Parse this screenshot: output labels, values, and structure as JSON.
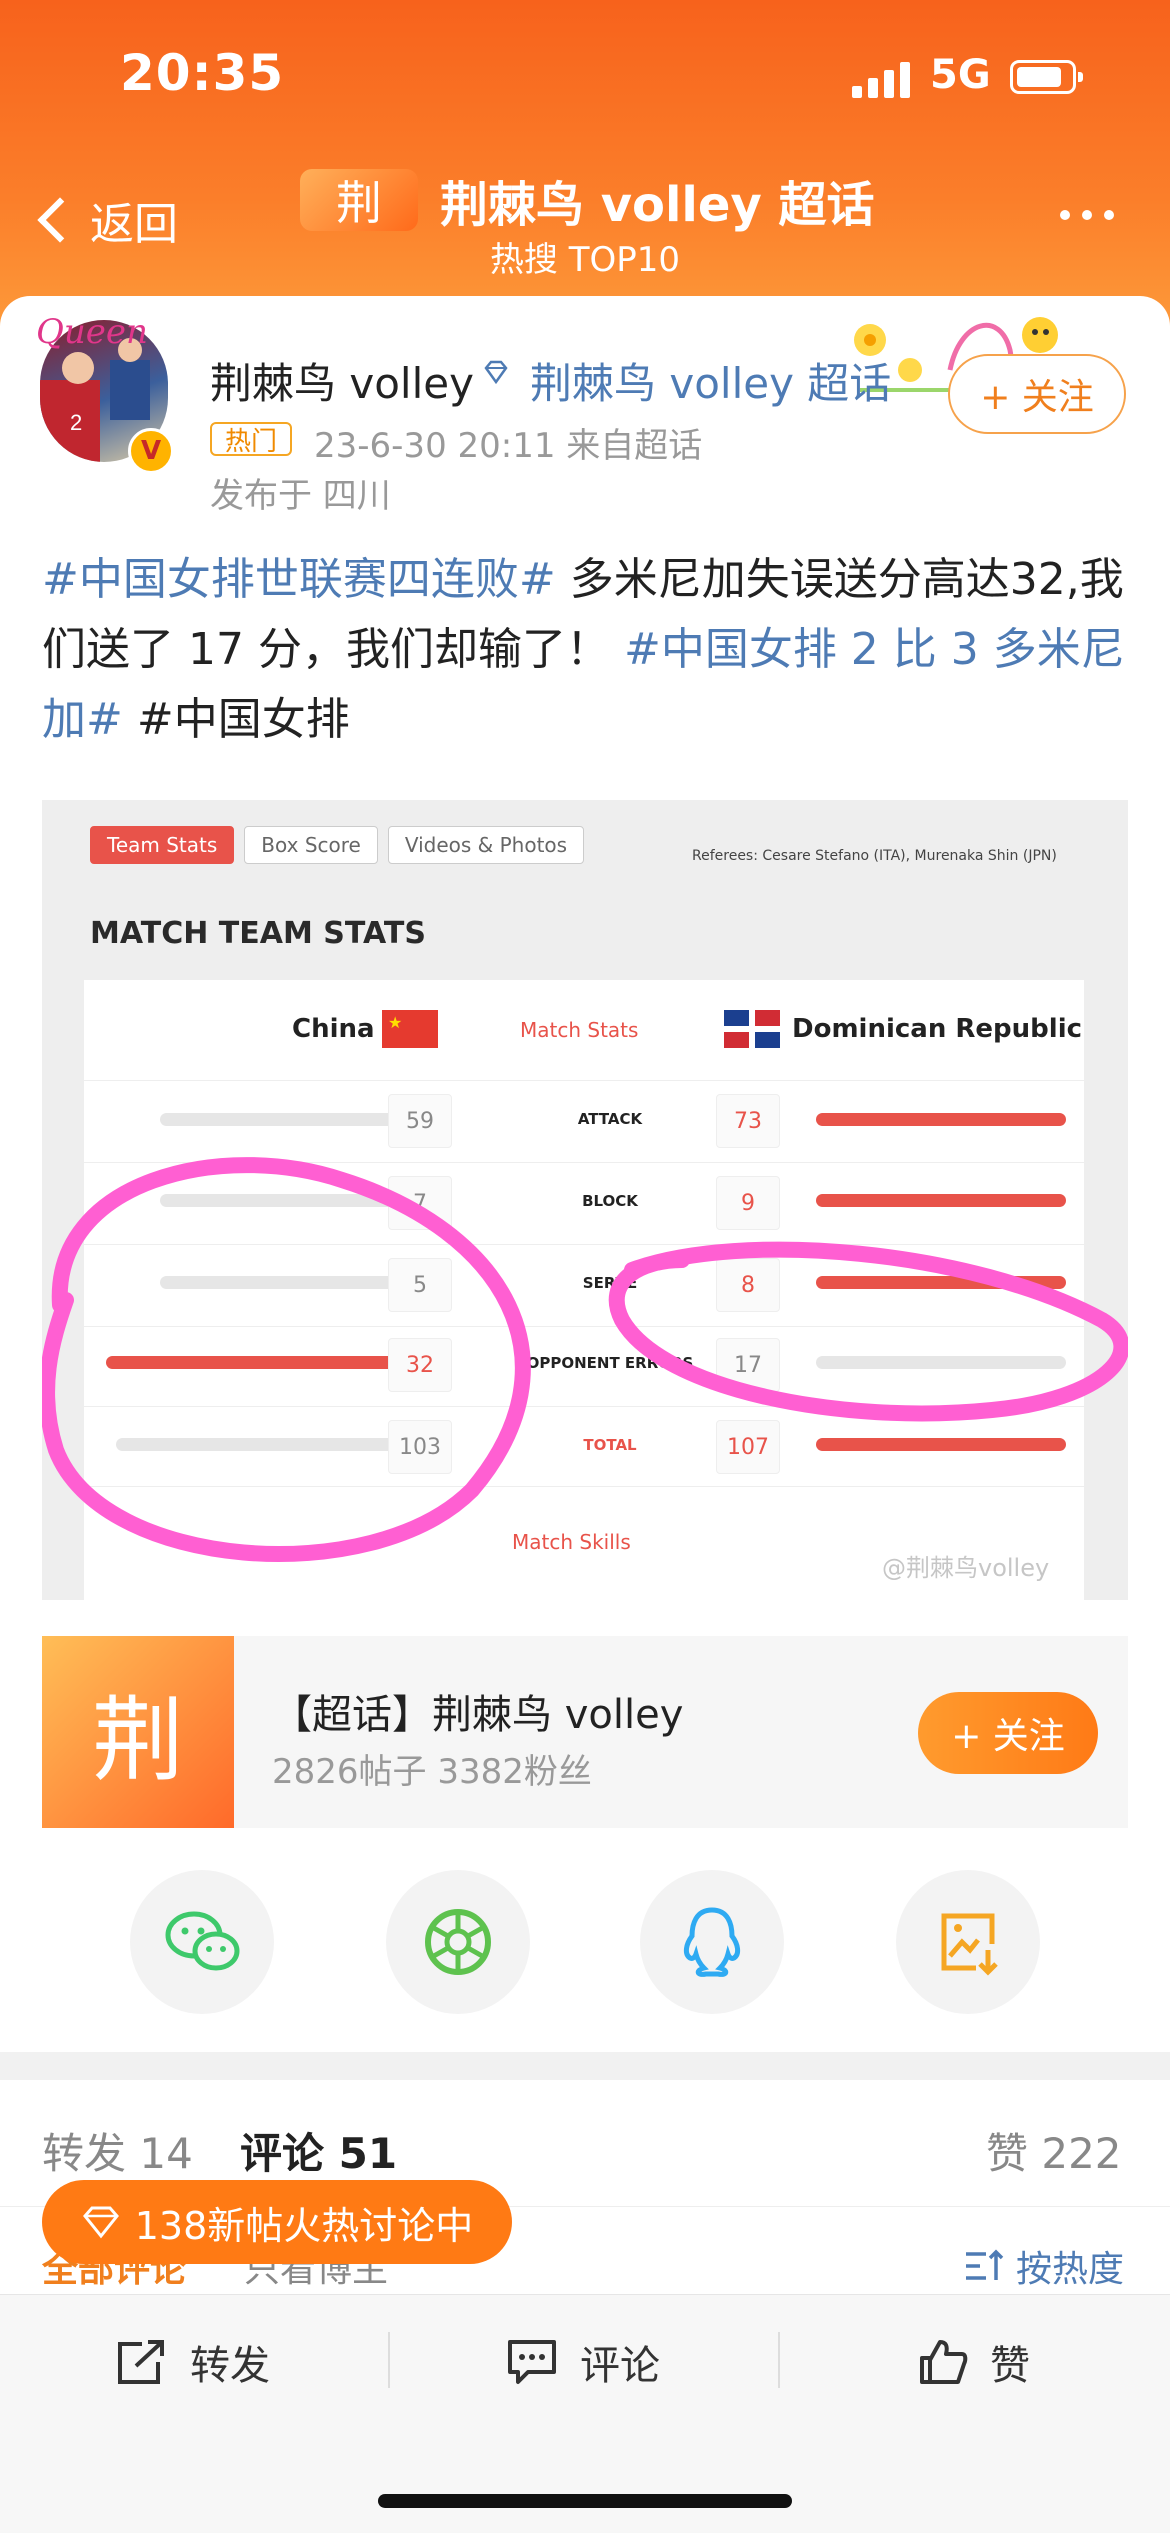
{
  "status": {
    "time": "20:35",
    "network": "5G"
  },
  "header": {
    "back_label": "返回",
    "title_logo": "荆",
    "title": "荆棘鸟 volley 超话",
    "subtitle": "热搜 TOP10"
  },
  "post": {
    "avatar_text": "Queen",
    "verify_mark": "V",
    "username": "荆棘鸟 volley",
    "super_link": "荆棘鸟 volley 超话",
    "hot_badge": "热门",
    "meta": "23-6-30 20:11  来自超话",
    "location": "发布于 四川",
    "follow_label": "+ 关注",
    "text": {
      "tag1": "#中国女排世联赛四连败#",
      "body": " 多米尼加失误送分高达32,我们送了 17 分，我们却输了！ ",
      "tag2": "#中国女排 2 比 3 多米尼加#",
      "tag3": " #中国女排"
    }
  },
  "screenshot": {
    "tabs": [
      "Team Stats",
      "Box Score",
      "Videos & Photos"
    ],
    "referees": "Referees: Cesare Stefano (ITA), Murenaka Shin (JPN)",
    "heading": "MATCH TEAM STATS",
    "team_left": "China",
    "middle_label": "Match Stats",
    "team_right": "Dominican Republic",
    "rows": [
      {
        "label": "ATTACK",
        "left": "59",
        "right": "73"
      },
      {
        "label": "BLOCK",
        "left": "7",
        "right": "9"
      },
      {
        "label": "SERVE",
        "left": "5",
        "right": "8"
      },
      {
        "label": "OPPONENT ERRORS",
        "left": "32",
        "right": "17"
      },
      {
        "label": "TOTAL",
        "left": "103",
        "right": "107"
      }
    ],
    "skills_label": "Match Skills",
    "watermark": "@荆棘鸟volley"
  },
  "topic": {
    "logo": "荆",
    "name": "【超话】荆棘鸟 volley",
    "stats": "2826帖子 3382粉丝",
    "follow_label": "+ 关注"
  },
  "share": [
    {
      "icon": "wechat-icon",
      "color": "#3ec96b"
    },
    {
      "icon": "moments-icon",
      "color": "#5ec24e"
    },
    {
      "icon": "qq-icon",
      "color": "#2eaaf2"
    },
    {
      "icon": "save-image-icon",
      "color": "#f5a623"
    }
  ],
  "stats": {
    "repost": "转发 14",
    "comment": "评论 51",
    "like": "赞 222"
  },
  "filters": {
    "all": "全部评论",
    "view": "只看博主",
    "sort": "按热度"
  },
  "hot_banner": "138新帖火热讨论中",
  "actions": {
    "repost": "转发",
    "comment": "评论",
    "like": "赞"
  },
  "colors": {
    "accent": "#f7621c",
    "link": "#4e7bb4",
    "highlight": "#ff5fd2"
  }
}
